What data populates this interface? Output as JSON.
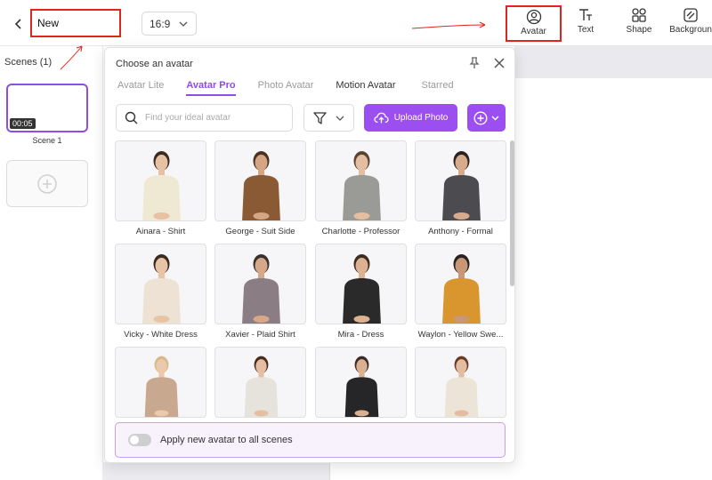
{
  "header": {
    "project_title": "New",
    "aspect_ratio": "16:9",
    "tools": [
      {
        "label": "Avatar",
        "icon": "user-circle-icon"
      },
      {
        "label": "Text",
        "icon": "text-icon"
      },
      {
        "label": "Shape",
        "icon": "shapes-icon"
      },
      {
        "label": "Backgroun",
        "icon": "background-icon"
      }
    ]
  },
  "scenes": {
    "title": "Scenes (1)",
    "items": [
      {
        "duration": "00:05",
        "label": "Scene 1"
      }
    ]
  },
  "avatar_panel": {
    "title": "Choose an avatar",
    "tabs": [
      "Avatar Lite",
      "Avatar Pro",
      "Photo Avatar",
      "Motion Avatar",
      "Starred"
    ],
    "active_tab": "Avatar Pro",
    "search_placeholder": "Find your ideal avatar",
    "upload_label": "Upload Photo",
    "avatars": [
      {
        "name": "Ainara - Shirt",
        "top": "#efe8d2",
        "hair": "#3a2a20",
        "skin": "#e6c1a3"
      },
      {
        "name": "George - Suit Side",
        "top": "#8a5a34",
        "hair": "#4a3222",
        "skin": "#d4a684"
      },
      {
        "name": "Charlotte - Professor",
        "top": "#9a9a96",
        "hair": "#5a4430",
        "skin": "#e3bea0"
      },
      {
        "name": "Anthony - Formal",
        "top": "#4c4c50",
        "hair": "#2a2220",
        "skin": "#d8ab8c"
      },
      {
        "name": "Vicky - White Dress",
        "top": "#ede2d4",
        "hair": "#3a2a20",
        "skin": "#e8c4a6"
      },
      {
        "name": "Xavier - Plaid Shirt",
        "top": "#8a7d84",
        "hair": "#3a3030",
        "skin": "#d6a888"
      },
      {
        "name": "Mira - Dress",
        "top": "#2a2a2a",
        "hair": "#3e2c22",
        "skin": "#dcb292"
      },
      {
        "name": "Waylon - Yellow Swe...",
        "top": "#d9952e",
        "hair": "#2a2220",
        "skin": "#c99676"
      },
      {
        "name": "",
        "top": "#c8a88e",
        "hair": "#d7b98a",
        "skin": "#ecc8ad"
      },
      {
        "name": "",
        "top": "#e6e2dc",
        "hair": "#4a2a1c",
        "skin": "#e6bfa3"
      },
      {
        "name": "",
        "top": "#262628",
        "hair": "#3a2c24",
        "skin": "#dbb090"
      },
      {
        "name": "",
        "top": "#ece4d6",
        "hair": "#6a3a26",
        "skin": "#e4bda0"
      }
    ],
    "apply_all_label": "Apply new avatar to all scenes"
  },
  "colors": {
    "accent": "#9b4ff0",
    "highlight": "#e0261c"
  }
}
